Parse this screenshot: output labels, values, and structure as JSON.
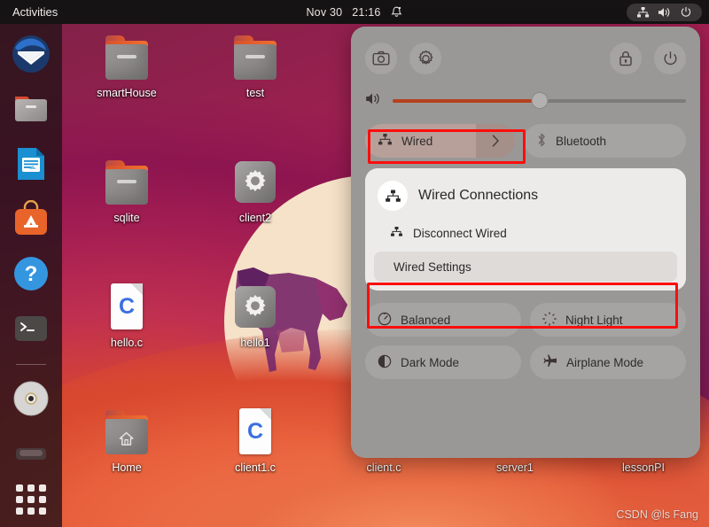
{
  "topbar": {
    "activities": "Activities",
    "date": "Nov 30",
    "time": "21:16",
    "notifications_icon": "bell-icon",
    "network_icon": "wired-network-icon",
    "volume_icon": "volume-icon",
    "power_icon": "power-icon"
  },
  "dock": {
    "items": [
      {
        "name": "thunderbird",
        "label": "Thunderbird Mail"
      },
      {
        "name": "files",
        "label": "Files"
      },
      {
        "name": "libreoffice-writer",
        "label": "LibreOffice Writer"
      },
      {
        "name": "ubuntu-software",
        "label": "Ubuntu Software"
      },
      {
        "name": "help",
        "label": "Help"
      },
      {
        "name": "terminal",
        "label": "Terminal"
      },
      {
        "name": "cd-drive",
        "label": "CD/DVD Drive"
      },
      {
        "name": "trash",
        "label": "Trash"
      }
    ],
    "app_grid_label": "Show Applications"
  },
  "desktop": {
    "icons": [
      {
        "label": "smartHouse",
        "type": "folder"
      },
      {
        "label": "test",
        "type": "folder"
      },
      {
        "label": "sqlite",
        "type": "folder"
      },
      {
        "label": "client2",
        "type": "executable"
      },
      {
        "label": "hello.c",
        "type": "c-file"
      },
      {
        "label": "hello1",
        "type": "executable"
      },
      {
        "label": "Home",
        "type": "home-folder"
      },
      {
        "label": "client1.c",
        "type": "c-file"
      },
      {
        "label": "client.c",
        "type": "c-file"
      },
      {
        "label": "server1",
        "type": "executable"
      },
      {
        "label": "lessonPI",
        "type": "executable"
      }
    ]
  },
  "panel": {
    "buttons": {
      "screenshot": "screenshot-icon",
      "settings": "settings-gear-icon",
      "lock": "lock-icon",
      "power": "power-icon"
    },
    "volume": {
      "icon": "volume-icon",
      "value": 50
    },
    "toggles": {
      "wired": "Wired",
      "bluetooth": "Bluetooth",
      "balanced": "Balanced",
      "night_light": "Night Light",
      "dark_mode": "Dark Mode",
      "airplane_mode": "Airplane Mode"
    },
    "submenu": {
      "title": "Wired Connections",
      "disconnect": "Disconnect Wired",
      "settings": "Wired Settings"
    }
  },
  "colors": {
    "accent_orange": "#b4411f",
    "annotation_red": "#fb0d0d",
    "panel_bg": "#9a9897",
    "active_tile": "#b8a09a"
  },
  "watermark": "CSDN @ls Fang"
}
